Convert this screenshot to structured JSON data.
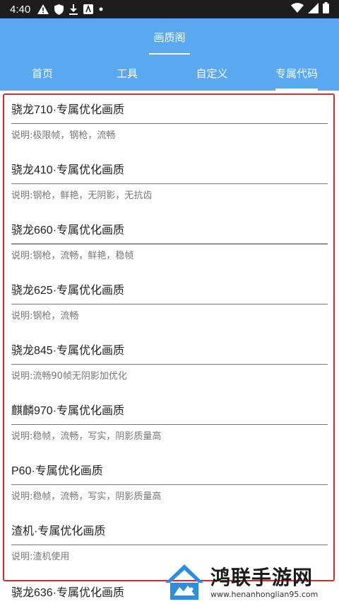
{
  "status_bar": {
    "time": "4:40",
    "left_icons": [
      "warning-icon",
      "shield-icon",
      "download-icon",
      "app-icon",
      "dot-icon"
    ],
    "right_icons": [
      "wifi-icon",
      "signal-icon",
      "battery-icon"
    ]
  },
  "header": {
    "title": "画质阁"
  },
  "tabs": [
    {
      "label": "首页"
    },
    {
      "label": "工具"
    },
    {
      "label": "自定义"
    },
    {
      "label": "专属代码",
      "active": true
    }
  ],
  "items": [
    {
      "name": "骁龙710·专属优化画质",
      "desc": "说明:极限帧，钢枪，流畅"
    },
    {
      "name": "骁龙410·专属优化画质",
      "desc": "说明:钢枪，鲜艳，无阴影，无抗齿"
    },
    {
      "name": "骁龙660·专属优化画质",
      "desc": "说明:钢枪，流畅，鲜艳，稳帧"
    },
    {
      "name": "骁龙625·专属优化画质",
      "desc": "说明:钢枪，流畅"
    },
    {
      "name": "骁龙845·专属优化画质",
      "desc": "说明:流畅90帧无阴影加优化"
    },
    {
      "name": "麒麟970·专属优化画质",
      "desc": "说明:稳帧，流畅，写实，阴影质量高"
    },
    {
      "name": "P60·专属优化画质",
      "desc": "说明:稳帧，流畅，写实，阴影质量高"
    },
    {
      "name": "渣机·专属优化画质",
      "desc": "说明:渣机使用"
    },
    {
      "name": "骁龙636·专属优化画质",
      "desc": ""
    }
  ],
  "watermark": {
    "title": "鸿联手游网",
    "url": "www.henanhonglian95.com"
  },
  "colors": {
    "accent": "#5aa8f0",
    "highlight_border": "#d92b2b",
    "status_bar": "#1d1d1d"
  }
}
